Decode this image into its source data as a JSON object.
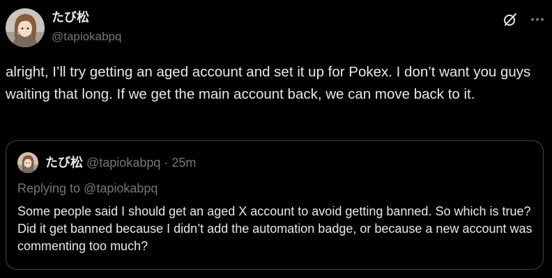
{
  "tweet": {
    "author": {
      "display_name": "たび松",
      "handle": "@tapiokabpq",
      "avatar": "profile-avatar"
    },
    "header_icons": [
      "grok-icon",
      "more-icon"
    ],
    "text": "alright, I’ll try getting an aged account and set it up for Pokex. I don’t want you guys waiting that long. If we get the main account back, we can move back to it."
  },
  "quoted_tweet": {
    "author": {
      "display_name": "たび松",
      "handle": "@tapiokabpq",
      "avatar": "profile-avatar"
    },
    "separator": "·",
    "timestamp": "25m",
    "replying_to": "Replying to @tapiokabpq",
    "text": "Some people said I should get an aged X account to avoid getting banned. So which is true? Did it get banned because I didn’t add the automation badge, or because a new account was commenting too much?"
  },
  "colors": {
    "background": "#000000",
    "primary_text": "#e7e9ea",
    "secondary_text": "#71767b",
    "card_border": "#3f4448"
  }
}
